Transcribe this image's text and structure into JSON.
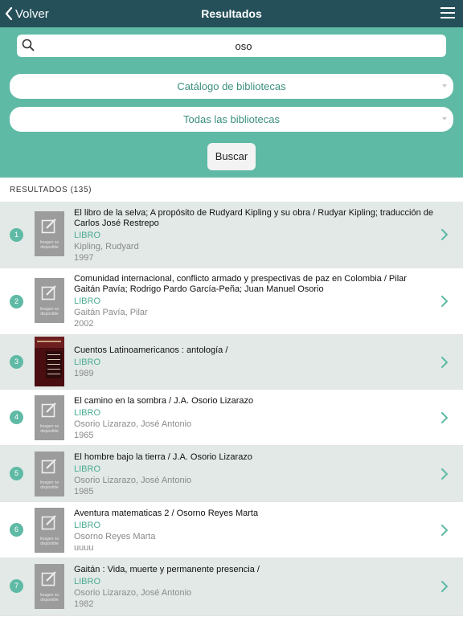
{
  "navbar": {
    "back_label": "Volver",
    "title": "Resultados",
    "back_icon": "chevron-left-icon",
    "menu_icon": "hamburger-menu-icon"
  },
  "search": {
    "value": "oso",
    "icon": "search-icon"
  },
  "filters": {
    "catalog": "Catálogo de bibliotecas",
    "library": "Todas las bibliotecas"
  },
  "search_button": "Buscar",
  "results_header": "RESULTADOS (135)",
  "placeholder_image_text": "Imagen no disponible",
  "colors": {
    "navbar": "#25505a",
    "accent": "#5fbaa5",
    "type_text": "#4aab93",
    "shaded_row": "#e2e9e7"
  },
  "results": [
    {
      "number": "1",
      "title": "El libro de la selva; A propósito de Rudyard Kipling y su obra / Rudyar Kipling; traducción de Carlos José Restrepo",
      "type": "LIBRO",
      "author": "Kipling, Rudyard",
      "year": "1997"
    },
    {
      "number": "2",
      "title": "Comunidad internacional, conflicto armado y prespectivas de paz en Colombia / Pilar Gaitán Pavía; Rodrigo Pardo García-Peña; Juan Manuel Osorio",
      "type": "LIBRO",
      "author": "Gaitán Pavía, Pilar",
      "year": "2002"
    },
    {
      "number": "3",
      "title": "Cuentos Latinoamericanos : antología /",
      "type": "LIBRO",
      "author": "",
      "year": "1989"
    },
    {
      "number": "4",
      "title": "El camino en la sombra / J.A. Osorio Lizarazo",
      "type": "LIBRO",
      "author": "Osorio Lizarazo, José Antonio",
      "year": "1965"
    },
    {
      "number": "5",
      "title": "El hombre bajo la tierra / J.A. Osorio Lizarazo",
      "type": "LIBRO",
      "author": "Osorio Lizarazo, José Antonio",
      "year": "1985"
    },
    {
      "number": "6",
      "title": "Aventura matematicas 2 / Osorno Reyes Marta",
      "type": "LIBRO",
      "author": "Osorno Reyes Marta",
      "year": "uuuu"
    },
    {
      "number": "7",
      "title": "Gaitán : Vida, muerte y permanente presencia /",
      "type": "LIBRO",
      "author": "Osorio Lizarazo, José Antonio",
      "year": "1982"
    }
  ]
}
